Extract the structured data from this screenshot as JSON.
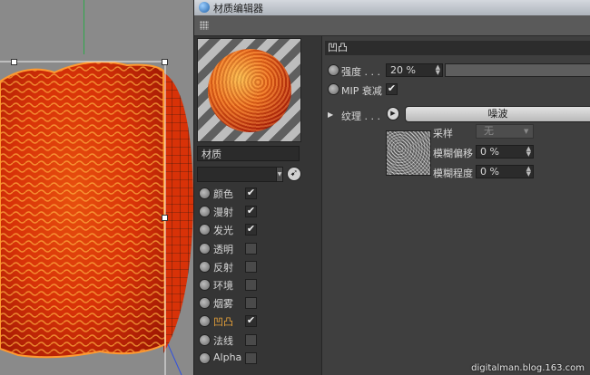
{
  "window": {
    "title": "材质编辑器"
  },
  "material": {
    "name": "材质",
    "channels": [
      {
        "label": "颜色",
        "enabled": true,
        "active": false
      },
      {
        "label": "漫射",
        "enabled": true,
        "active": false
      },
      {
        "label": "发光",
        "enabled": true,
        "active": false
      },
      {
        "label": "透明",
        "enabled": false,
        "active": false
      },
      {
        "label": "反射",
        "enabled": false,
        "active": false
      },
      {
        "label": "环境",
        "enabled": false,
        "active": false
      },
      {
        "label": "烟雾",
        "enabled": false,
        "active": false
      },
      {
        "label": "凹凸",
        "enabled": true,
        "active": true
      },
      {
        "label": "法线",
        "enabled": false,
        "active": false
      },
      {
        "label": "Alpha",
        "enabled": false,
        "active": false
      }
    ]
  },
  "bump": {
    "section_title": "凹凸",
    "strength_label": "强度 . . .",
    "strength_value": "20 %",
    "mip_label": "MIP 衰减",
    "mip_checked": true,
    "texture_label": "纹理 . . .",
    "texture_button": "噪波",
    "sample_label": "采样",
    "sample_value": "无",
    "blur_offset_label": "模糊偏移",
    "blur_offset_value": "0 %",
    "blur_scale_label": "模糊程度",
    "blur_scale_value": "0 %"
  },
  "icons": {
    "title": "cinema4d-logo-icon",
    "grip": "grip-icon",
    "pick": "pick-cursor-icon",
    "check": "✔"
  },
  "colors": {
    "active_channel": "#e8a23a",
    "material_orange": "#f06418"
  },
  "watermark": "digitalman.blog.163.com"
}
